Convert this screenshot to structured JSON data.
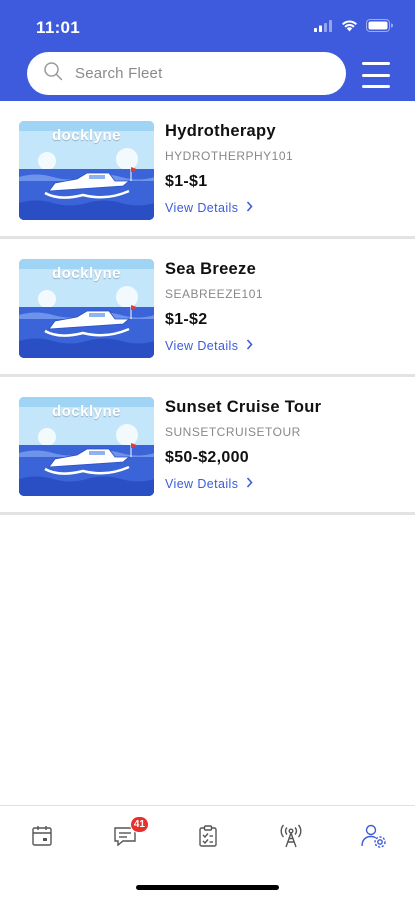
{
  "status_bar": {
    "time": "11:01"
  },
  "search": {
    "placeholder": "Search Fleet",
    "value": ""
  },
  "brand": "docklyne",
  "vessels": [
    {
      "name": "Hydrotherapy",
      "code": "HYDROTHERPHY101",
      "price": "$1-$1",
      "details_label": "View Details"
    },
    {
      "name": "Sea Breeze",
      "code": "SEABREEZE101",
      "price": "$1-$2",
      "details_label": "View Details"
    },
    {
      "name": "Sunset Cruise Tour",
      "code": "SUNSETCRUISETOUR",
      "price": "$50-$2,000",
      "details_label": "View Details"
    }
  ],
  "bottom_nav": {
    "items": [
      {
        "icon": "calendar-icon"
      },
      {
        "icon": "chat-icon",
        "badge": "41"
      },
      {
        "icon": "checklist-icon"
      },
      {
        "icon": "broadcast-tower-icon"
      },
      {
        "icon": "user-settings-icon",
        "active": true
      }
    ]
  },
  "colors": {
    "primary": "#3d5bdc",
    "badge": "#e5312d",
    "inactive_icon": "#555555"
  }
}
